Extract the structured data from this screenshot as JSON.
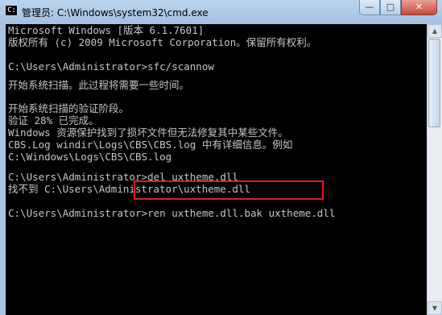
{
  "window": {
    "title": "管理员: C:\\Windows\\system32\\cmd.exe",
    "icon": "cmd-icon",
    "controls": {
      "minimize": "—",
      "maximize": "□",
      "close": "✕"
    }
  },
  "console": {
    "lines": [
      "Microsoft Windows [版本 6.1.7601]",
      "版权所有 (c) 2009 Microsoft Corporation。保留所有权利。",
      "",
      "C:\\Users\\Administrator>sfc/scannow",
      "",
      "开始系统扫描。此过程将需要一些时间。",
      "",
      "开始系统扫描的验证阶段。",
      "验证 28% 已完成。",
      "Windows 资源保护找到了损坏文件但无法修复其中某些文件。",
      "CBS.Log windir\\Logs\\CBS\\CBS.log 中有详细信息。例如",
      "C:\\Windows\\Logs\\CBS\\CBS.log",
      "",
      "C:\\Users\\Administrator>del uxtheme.dll",
      "找不到 C:\\Users\\Administrator\\uxtheme.dll",
      "",
      "C:\\Users\\Administrator>ren uxtheme.dll.bak uxtheme.dll"
    ]
  },
  "colors": {
    "console_bg": "#000000",
    "console_text": "#c6c6c6",
    "highlight": "#e11b1b",
    "frame": "#a8c6e4"
  }
}
